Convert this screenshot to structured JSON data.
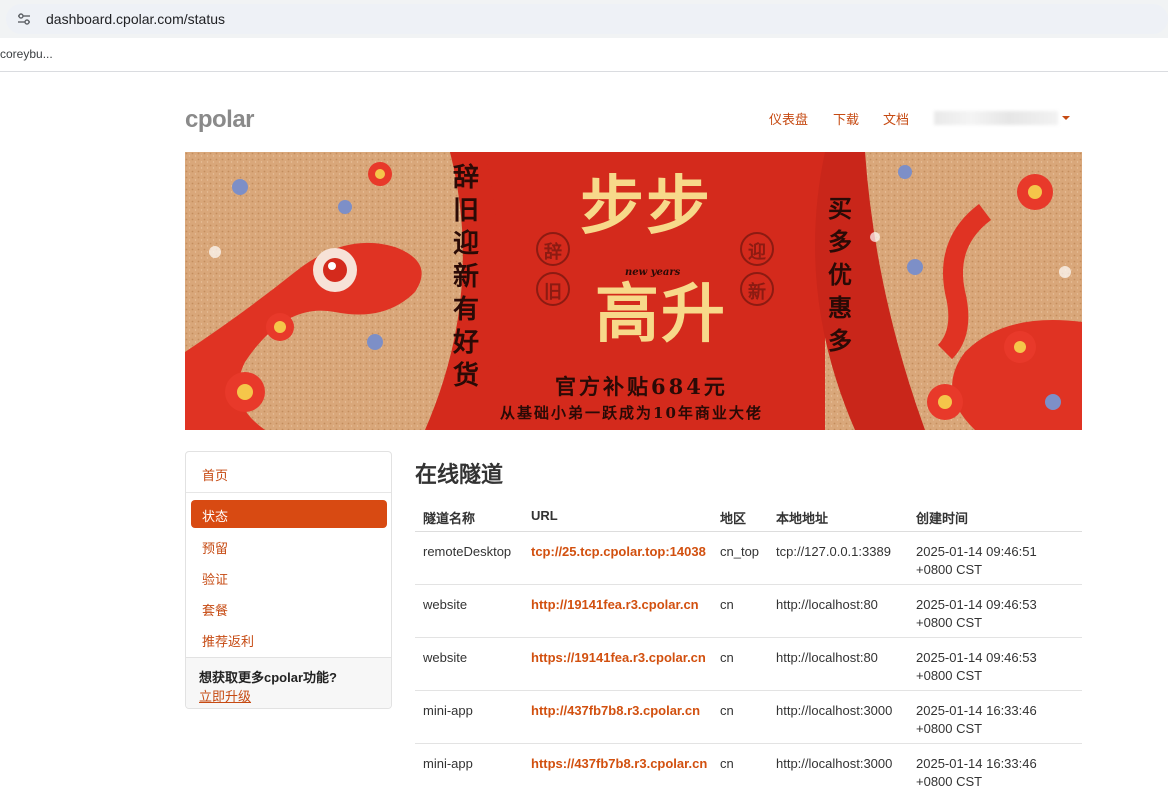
{
  "browser": {
    "url": "dashboard.cpolar.com/status",
    "bookmark": "coreybu..."
  },
  "header": {
    "logo": "cpolar",
    "nav": [
      "仪表盘",
      "下载",
      "文档"
    ]
  },
  "banner": {
    "left_slogan": "辞旧迎新有好货",
    "seal_left_1": "辞",
    "seal_left_2": "旧",
    "seal_right_1": "迎",
    "seal_right_2": "新",
    "headline_1": "步步",
    "headline_2": "高升",
    "tagline_small": "new years",
    "subsidy": "官方补贴684元",
    "subline": "从基础小弟一跃成为10年商业大佬",
    "right_slogan": "买多优惠多"
  },
  "sidebar": {
    "home": "首页",
    "active": "状态",
    "items": [
      "预留",
      "验证",
      "套餐",
      "推荐返利"
    ],
    "promo_question": "想获取更多cpolar功能?",
    "promo_link": "立即升级"
  },
  "main": {
    "title": "在线隧道",
    "columns": [
      "隧道名称",
      "URL",
      "地区",
      "本地地址",
      "创建时间"
    ],
    "rows": [
      {
        "name": "remoteDesktop",
        "url": "tcp://25.tcp.cpolar.top:14038",
        "region": "cn_top",
        "local": "tcp://127.0.0.1:3389",
        "created_1": "2025-01-14 09:46:51",
        "created_2": "+0800 CST"
      },
      {
        "name": "website",
        "url": "http://19141fea.r3.cpolar.cn",
        "region": "cn",
        "local": "http://localhost:80",
        "created_1": "2025-01-14 09:46:53",
        "created_2": "+0800 CST"
      },
      {
        "name": "website",
        "url": "https://19141fea.r3.cpolar.cn",
        "region": "cn",
        "local": "http://localhost:80",
        "created_1": "2025-01-14 09:46:53",
        "created_2": "+0800 CST"
      },
      {
        "name": "mini-app",
        "url": "http://437fb7b8.r3.cpolar.cn",
        "region": "cn",
        "local": "http://localhost:3000",
        "created_1": "2025-01-14 16:33:46",
        "created_2": "+0800 CST"
      },
      {
        "name": "mini-app",
        "url": "https://437fb7b8.r3.cpolar.cn",
        "region": "cn",
        "local": "http://localhost:3000",
        "created_1": "2025-01-14 16:33:46",
        "created_2": "+0800 CST"
      }
    ]
  },
  "colors": {
    "accent": "#c64a12",
    "active_bg": "#d84a12",
    "banner_red": "#d42a1c"
  }
}
